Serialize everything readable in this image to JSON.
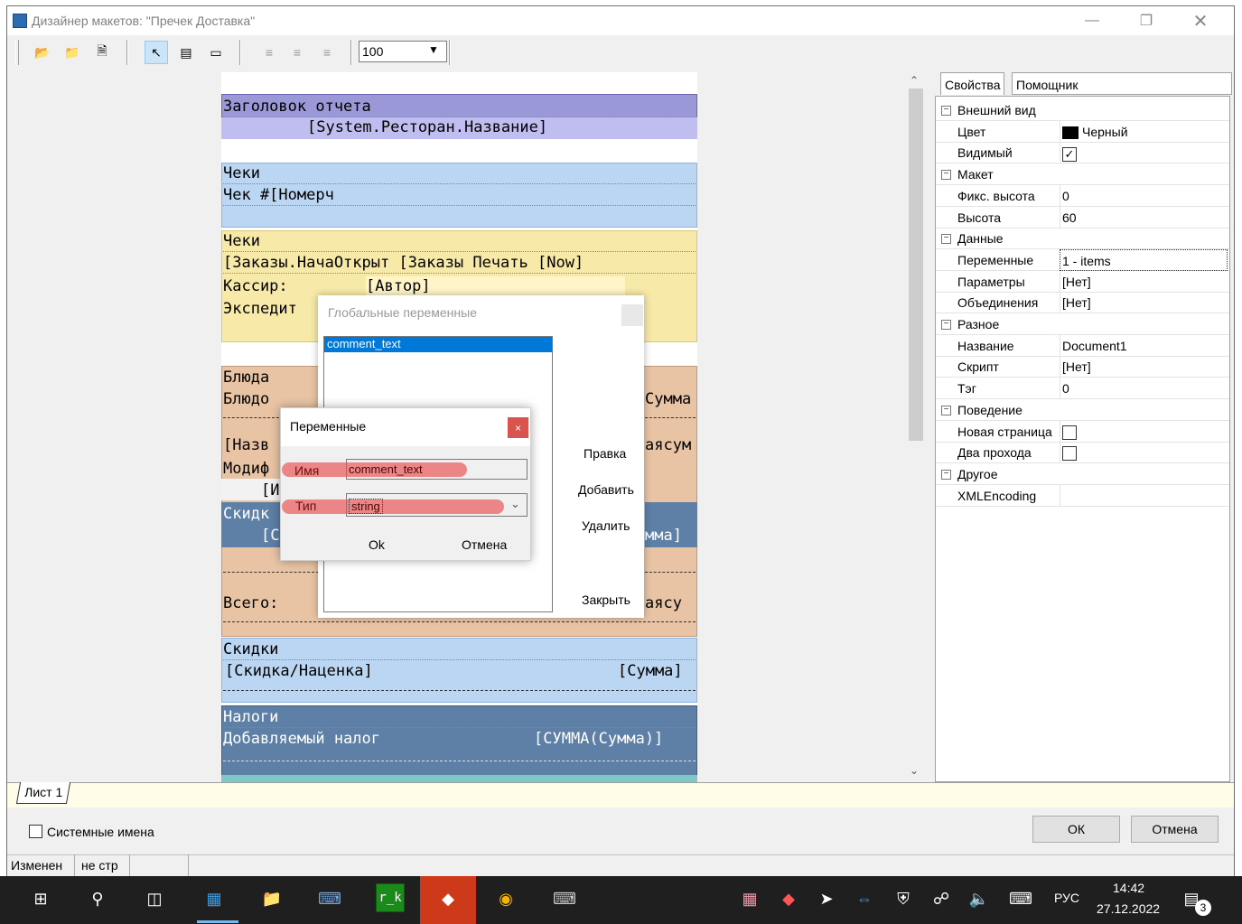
{
  "window": {
    "title": "Дизайнер макетов: \"Пречек Доставка\""
  },
  "toolbar": {
    "zoom_value": "100"
  },
  "report": {
    "header_title": "Заголовок отчета",
    "header_field": "[System.Ресторан.Название]",
    "checks_band_1": "Чеки",
    "checks_band_1_field": "Чек #[Номерч",
    "checks_band_2": "Чеки",
    "orders_row": "[Заказы.НачаОткрыт [Заказы  Печать [Now]",
    "cashier_label": "Кассир:",
    "cashier_value": "[Автор]",
    "expeditor_label": "Экспедит",
    "dishes_band": "Блюда",
    "dish_label": "Блюдо",
    "sum_right": "Сумма",
    "name_left": "[Назв",
    "sum_right_2": "аясум",
    "mod_label": "Модиф",
    "mod_field": "[И",
    "discount_left": "Скидк",
    "discount_field_left": "[С",
    "sum_right_3": "мма]",
    "total_label": "Всего:",
    "total_right": "аясу",
    "discounts_band": "Скидки",
    "discount_markup": "[Скидка/Наценка]",
    "discount_sum": "[Сумма]",
    "taxes_band": "Налоги",
    "vat_label": "Добавляемый налог",
    "vat_sum": "[СУММА(Сумма)]"
  },
  "sheet_tab": "Лист 1",
  "system_names_label": "Системные имена",
  "status": {
    "changed": "Изменен",
    "page": "не стр"
  },
  "buttons": {
    "ok": "ОК",
    "cancel": "Отмена"
  },
  "props_tabs": {
    "properties": "Свойства",
    "helper": "Помощник"
  },
  "properties": [
    {
      "type": "cat",
      "name": "Внешний вид"
    },
    {
      "type": "prop",
      "name": "Цвет",
      "value": "Черный",
      "swatch": "#000000"
    },
    {
      "type": "prop",
      "name": "Видимый",
      "value": "",
      "checkbox": true,
      "checked": true
    },
    {
      "type": "cat",
      "name": "Макет"
    },
    {
      "type": "prop",
      "name": "Фикс. высота",
      "value": "0"
    },
    {
      "type": "prop",
      "name": "Высота",
      "value": "60"
    },
    {
      "type": "cat",
      "name": "Данные"
    },
    {
      "type": "prop",
      "name": "Переменные",
      "value": "1 - items",
      "selected": true
    },
    {
      "type": "prop",
      "name": "Параметры",
      "value": "[Нет]"
    },
    {
      "type": "prop",
      "name": "Объединения",
      "value": "[Нет]"
    },
    {
      "type": "cat",
      "name": "Разное"
    },
    {
      "type": "prop",
      "name": "Название",
      "value": "Document1"
    },
    {
      "type": "prop",
      "name": "Скрипт",
      "value": "[Нет]"
    },
    {
      "type": "prop",
      "name": "Тэг",
      "value": "0"
    },
    {
      "type": "cat",
      "name": "Поведение"
    },
    {
      "type": "prop",
      "name": "Новая страница",
      "value": "",
      "checkbox": true,
      "checked": false
    },
    {
      "type": "prop",
      "name": "Два прохода",
      "value": "",
      "checkbox": true,
      "checked": false
    },
    {
      "type": "cat",
      "name": "Другое"
    },
    {
      "type": "prop",
      "name": "XMLEncoding",
      "value": ""
    }
  ],
  "global_vars_dialog": {
    "title": "Глобальные переменные",
    "items": [
      "comment_text"
    ],
    "edit": "Правка",
    "add": "Добавить",
    "delete": "Удалить",
    "close": "Закрыть"
  },
  "vars_dialog": {
    "title": "Переменные",
    "name_label": "Имя",
    "name_value": "comment_text",
    "type_label": "Тип",
    "type_value": "string",
    "ok": "Ok",
    "cancel": "Отмена"
  },
  "taskbar": {
    "lang": "РУС",
    "time": "14:42",
    "date": "27.12.2022",
    "notifications": "3"
  }
}
